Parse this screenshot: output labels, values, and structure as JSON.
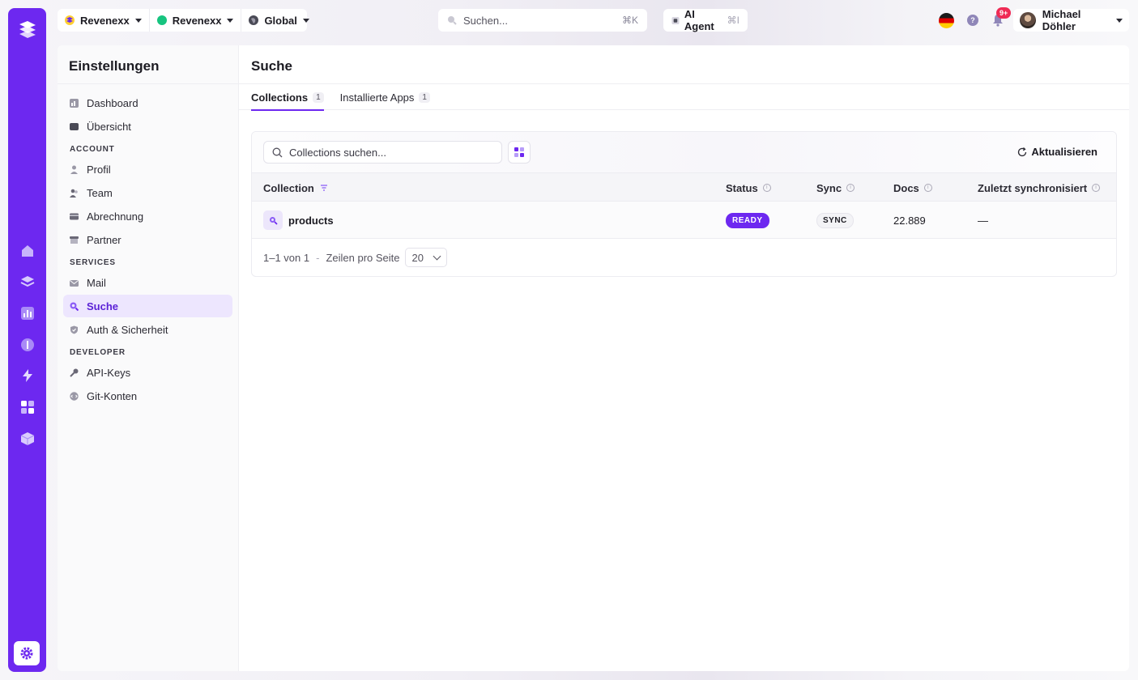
{
  "topbar": {
    "org1": {
      "label": "Revenexx"
    },
    "org2": {
      "label": "Revenexx",
      "dot_color": "#16c47f"
    },
    "scope": {
      "label": "Global"
    },
    "search": {
      "placeholder": "Suchen...",
      "shortcut": "⌘K"
    },
    "agent": {
      "label": "AI Agent",
      "shortcut": "⌘I"
    },
    "notifications": {
      "badge": "9+"
    },
    "help_label": "?",
    "user": {
      "name": "Michael Döhler"
    }
  },
  "sidebar": {
    "title": "Einstellungen",
    "items_top": [
      {
        "label": "Dashboard",
        "icon": "dashboard-icon"
      },
      {
        "label": "Übersicht",
        "icon": "overview-icon"
      }
    ],
    "sections": [
      {
        "title": "ACCOUNT",
        "items": [
          {
            "label": "Profil",
            "icon": "user-icon"
          },
          {
            "label": "Team",
            "icon": "team-icon"
          },
          {
            "label": "Abrechnung",
            "icon": "billing-icon"
          },
          {
            "label": "Partner",
            "icon": "store-icon"
          }
        ]
      },
      {
        "title": "SERVICES",
        "items": [
          {
            "label": "Mail",
            "icon": "mail-icon"
          },
          {
            "label": "Suche",
            "icon": "search-icon",
            "active": true
          },
          {
            "label": "Auth & Sicherheit",
            "icon": "shield-icon"
          }
        ]
      },
      {
        "title": "DEVELOPER",
        "items": [
          {
            "label": "API-Keys",
            "icon": "key-icon"
          },
          {
            "label": "Git-Konten",
            "icon": "git-icon"
          }
        ]
      }
    ]
  },
  "main": {
    "title": "Suche",
    "tabs": [
      {
        "label": "Collections",
        "count": "1",
        "active": true
      },
      {
        "label": "Installierte Apps",
        "count": "1",
        "active": false
      }
    ],
    "toolbar": {
      "search_placeholder": "Collections suchen...",
      "refresh_label": "Aktualisieren"
    },
    "table": {
      "columns": [
        "Collection",
        "Status",
        "Sync",
        "Docs",
        "Zuletzt synchronisiert"
      ],
      "rows": [
        {
          "name": "products",
          "status": "READY",
          "sync": "SYNC",
          "docs": "22.889",
          "last_sync": "—"
        }
      ]
    },
    "pager": {
      "range": "1–1 von 1",
      "separator": "-",
      "rows_label": "Zeilen pro Seite",
      "page_size": "20"
    }
  },
  "colors": {
    "accent": "#6d28f0",
    "accent_light": "#ede6fe",
    "badge": "#ef2b55",
    "ready": "#6d28f0"
  }
}
